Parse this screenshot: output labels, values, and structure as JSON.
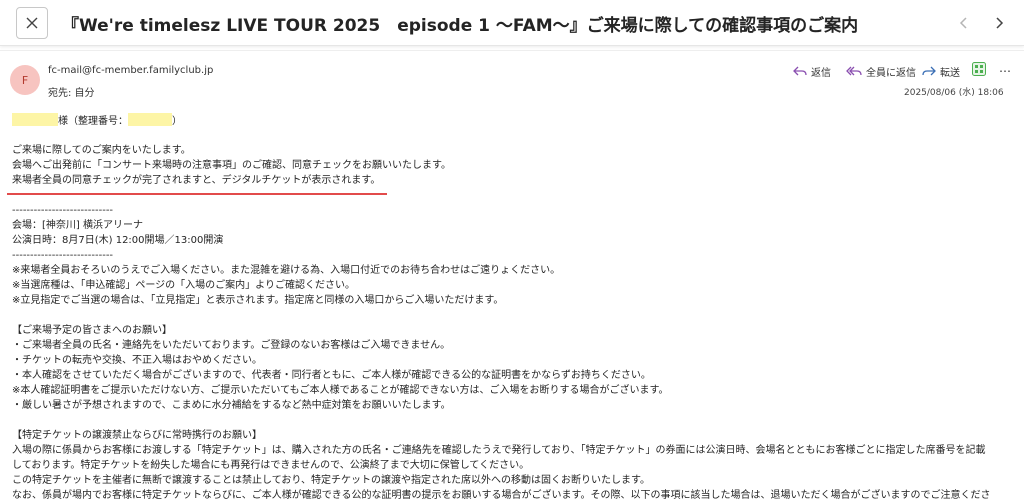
{
  "window": {
    "subject": "『We're timelesz LIVE TOUR 2025　episode 1 〜FAM〜』ご来場に際しての確認事項のご案内"
  },
  "message": {
    "avatar_initial": "F",
    "sender": "fc-mail@fc-member.familyclub.jp",
    "to": "宛先: 自分",
    "date": "2025/08/06 (水) 18:06",
    "actions": {
      "reply": "返信",
      "reply_all": "全員に返信",
      "forward": "転送",
      "more": "…"
    }
  },
  "colors": {
    "highlight": "#fdf5a6",
    "underline": "#e24b4b",
    "avatar_bg": "#f7c4c0",
    "action_icon": "#8a4fb0"
  },
  "body": {
    "greeting_suffix": "様（整理番号：",
    "greeting_close": "）",
    "l1": "ご来場に際してのご案内をいたします。",
    "l2": "会場へご出発前に「コンサート来場時の注意事項」のご確認、同意チェックをお願いいたします。",
    "l3": "来場者全員の同意チェックが完了されますと、デジタルチケットが表示されます。",
    "sep1": "----------------------------",
    "venue": "会場：[神奈川] 横浜アリーナ",
    "show_date": "公演日時：8月7日(木) 12:00開場／13:00開演",
    "sep2": "----------------------------",
    "n1": "※来場者全員おそろいのうえでご入場ください。また混雑を避ける為、入場口付近でのお待ち合わせはご遠りょください。",
    "n2": "※当選席種は、「申込確認」ページの「入場のご案内」よりご確認ください。",
    "n3": "※立見指定でご当選の場合は、「立見指定」と表示されます。指定席と同様の入場口からご入場いただけます。",
    "req_title": "【ご来場予定の皆さまへのお願い】",
    "r1": "・ご来場者全員の氏名・連絡先をいただいております。ご登録のないお客様はご入場できません。",
    "r2": "・チケットの転売や交換、不正入場はおやめください。",
    "r3": "・本人確認をさせていただく場合がございますので、代表者・同行者ともに、ご本人様が確認できる公的な証明書をかならずお持ちください。",
    "r4": "※本人確認証明書をご提示いただけない方、ご提示いただいてもご本人様であることが確認できない方は、ご入場をお断りする場合がございます。",
    "r5": "・厳しい暑さが予想されますので、こまめに水分補給をするなど熱中症対策をお願いいたします。",
    "sp_title": "【特定チケットの譲渡禁止ならびに常時携行のお願い】",
    "s1": "入場の際に係員からお客様にお渡しする「特定チケット」は、購入された方の氏名・ご連絡先を確認したうえで発行しており、「特定チケット」の券面には公演日時、会場名とともにお客様ごとに指定した席番号を記載",
    "s2": "しております。特定チケットを紛失した場合にも再発行はできませんので、公演終了まで大切に保管してください。",
    "s3": "この特定チケットを主催者に無断で譲渡することは禁止しており、特定チケットの譲渡や指定された席以外への移動は固くお断りいたします。",
    "s4": "なお、係員が場内でお客様に特定チケットならびに、ご本人様が確認できる公的な証明書の提示をお願いする場合がございます。その際、以下の事項に該当した場合は、退場いただく場合がございますのでご注意くださ"
  }
}
